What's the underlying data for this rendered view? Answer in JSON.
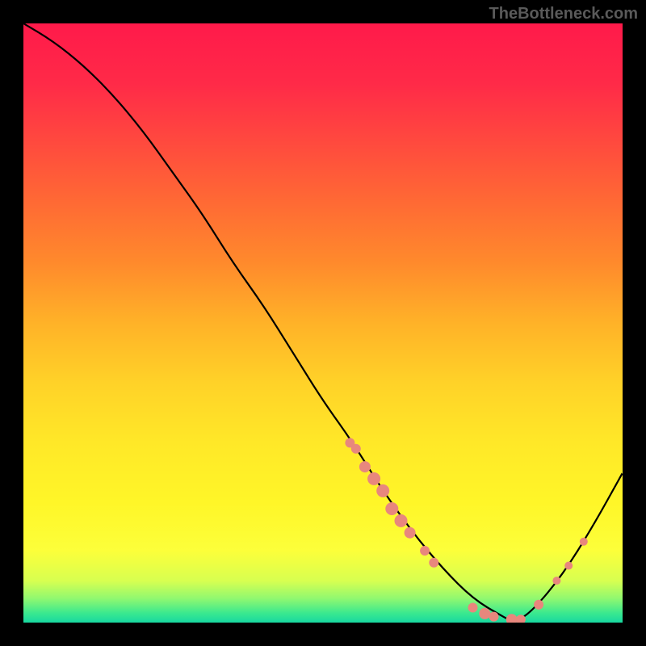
{
  "watermark": "TheBottleneck.com",
  "chart_data": {
    "type": "line",
    "title": "",
    "xlabel": "",
    "ylabel": "",
    "xlim": [
      0,
      100
    ],
    "ylim": [
      0,
      100
    ],
    "curve": {
      "x": [
        0,
        5,
        10,
        15,
        20,
        25,
        30,
        35,
        40,
        45,
        50,
        55,
        60,
        65,
        70,
        75,
        80,
        82,
        85,
        90,
        95,
        100
      ],
      "y": [
        100,
        97,
        93,
        88,
        82,
        75,
        68,
        60,
        53,
        45,
        37,
        30,
        22,
        15,
        9,
        4,
        1,
        0,
        2,
        8,
        16,
        25
      ]
    },
    "dots": [
      {
        "x": 54.5,
        "y": 30,
        "r": 6
      },
      {
        "x": 55.5,
        "y": 29,
        "r": 6
      },
      {
        "x": 57.0,
        "y": 26,
        "r": 7
      },
      {
        "x": 58.5,
        "y": 24,
        "r": 8
      },
      {
        "x": 60.0,
        "y": 22,
        "r": 8
      },
      {
        "x": 61.5,
        "y": 19,
        "r": 8
      },
      {
        "x": 63.0,
        "y": 17,
        "r": 8
      },
      {
        "x": 64.5,
        "y": 15,
        "r": 7
      },
      {
        "x": 67.0,
        "y": 12,
        "r": 6
      },
      {
        "x": 68.5,
        "y": 10,
        "r": 6
      },
      {
        "x": 75.0,
        "y": 2.5,
        "r": 6
      },
      {
        "x": 77.0,
        "y": 1.5,
        "r": 7
      },
      {
        "x": 78.5,
        "y": 1.0,
        "r": 6
      },
      {
        "x": 81.5,
        "y": 0.5,
        "r": 7
      },
      {
        "x": 83.0,
        "y": 0.5,
        "r": 6
      },
      {
        "x": 86.0,
        "y": 3.0,
        "r": 6
      },
      {
        "x": 89.0,
        "y": 7.0,
        "r": 5
      },
      {
        "x": 91.0,
        "y": 9.5,
        "r": 5
      },
      {
        "x": 93.5,
        "y": 13.5,
        "r": 5
      }
    ],
    "gradient_stops": [
      {
        "pos": 0.0,
        "color": "#ff1a4a"
      },
      {
        "pos": 0.1,
        "color": "#ff2a48"
      },
      {
        "pos": 0.2,
        "color": "#ff4a3e"
      },
      {
        "pos": 0.3,
        "color": "#ff6a34"
      },
      {
        "pos": 0.4,
        "color": "#ff8a2c"
      },
      {
        "pos": 0.5,
        "color": "#ffb228"
      },
      {
        "pos": 0.6,
        "color": "#ffd228"
      },
      {
        "pos": 0.7,
        "color": "#ffe828"
      },
      {
        "pos": 0.8,
        "color": "#fff628"
      },
      {
        "pos": 0.88,
        "color": "#fcff3a"
      },
      {
        "pos": 0.93,
        "color": "#d8ff50"
      },
      {
        "pos": 0.96,
        "color": "#90f870"
      },
      {
        "pos": 0.985,
        "color": "#38e890"
      },
      {
        "pos": 1.0,
        "color": "#18d8a0"
      }
    ],
    "dot_color": "#e8877d",
    "curve_color": "#000000"
  }
}
